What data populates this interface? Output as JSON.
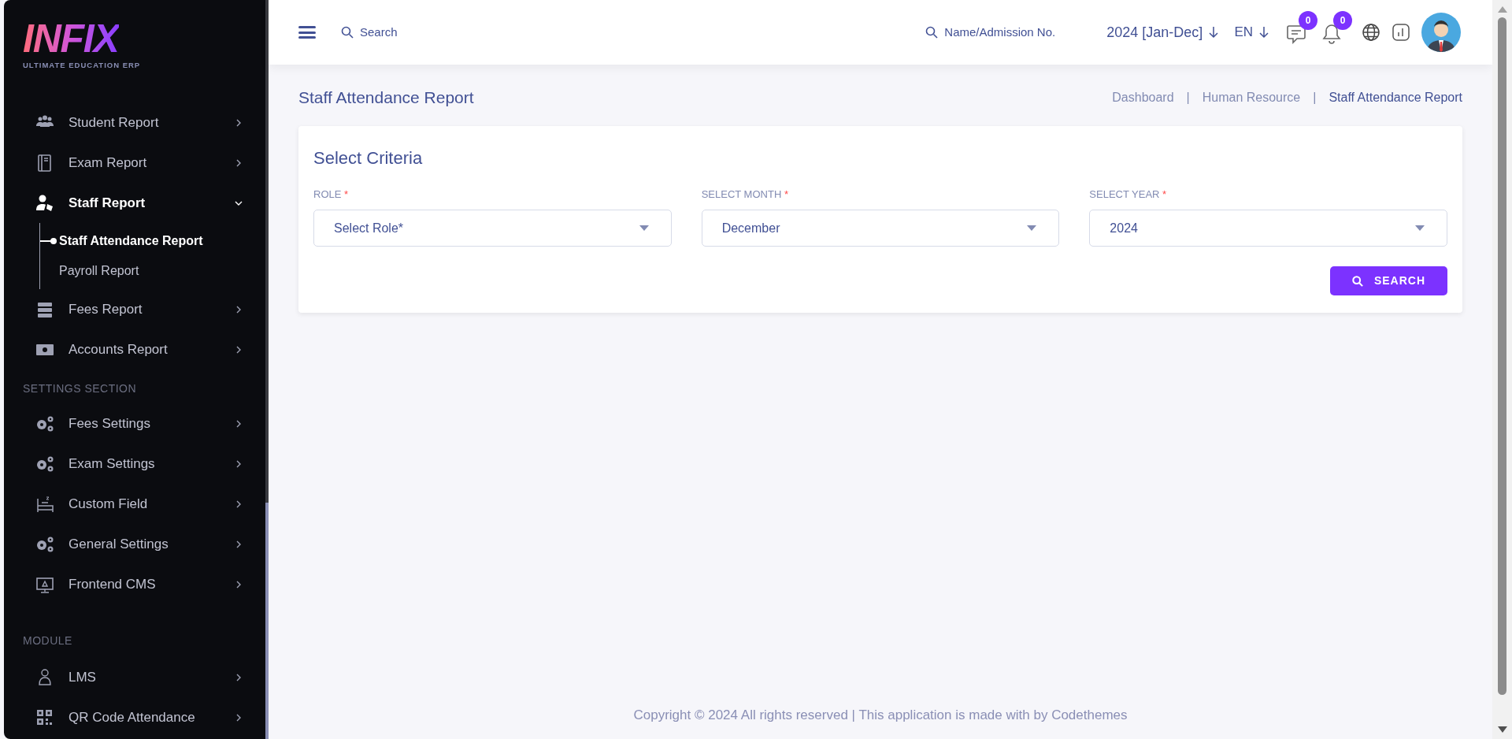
{
  "logo": {
    "name": "INFIX",
    "tagline": "ULTIMATE EDUCATION ERP"
  },
  "sidebar": {
    "groups": [
      {
        "items": [
          {
            "label": "Student Report",
            "expanded": false
          },
          {
            "label": "Exam Report",
            "expanded": false
          },
          {
            "label": "Staff Report",
            "expanded": true,
            "children": [
              {
                "label": "Staff Attendance Report",
                "selected": true
              },
              {
                "label": "Payroll Report",
                "selected": false
              }
            ]
          },
          {
            "label": "Fees Report",
            "expanded": false
          },
          {
            "label": "Accounts Report",
            "expanded": false
          }
        ]
      },
      {
        "heading": "SETTINGS SECTION",
        "items": [
          {
            "label": "Fees Settings",
            "expanded": false
          },
          {
            "label": "Exam Settings",
            "expanded": false
          },
          {
            "label": "Custom Field",
            "expanded": false
          },
          {
            "label": "General Settings",
            "expanded": false
          },
          {
            "label": "Frontend CMS",
            "expanded": false
          }
        ]
      },
      {
        "heading": "MODULE",
        "items": [
          {
            "label": "LMS",
            "expanded": false
          },
          {
            "label": "QR Code Attendance",
            "expanded": false
          }
        ]
      }
    ]
  },
  "topbar": {
    "search": {
      "placeholder": "Search"
    },
    "student_search": {
      "placeholder": "Name/Admission No."
    },
    "session": "2024 [Jan-Dec]",
    "language": "EN",
    "messages_count": "0",
    "notifications_count": "0"
  },
  "page": {
    "title": "Staff Attendance Report",
    "breadcrumb_separator": "|",
    "breadcrumb": [
      {
        "label": "Dashboard",
        "current": false
      },
      {
        "label": "Human Resource",
        "current": false
      },
      {
        "label": "Staff Attendance Report",
        "current": true
      }
    ]
  },
  "criteria": {
    "title": "Select Criteria",
    "fields": [
      {
        "label": "ROLE",
        "required_mark": "*",
        "placeholder": "Select Role*"
      },
      {
        "label": "SELECT MONTH",
        "required_mark": "*",
        "value": "December"
      },
      {
        "label": "SELECT YEAR",
        "required_mark": "*",
        "value": "2024"
      }
    ],
    "button": "SEARCH"
  },
  "footer": "Copyright © 2024 All rights reserved | This application is made with by Codethemes"
}
